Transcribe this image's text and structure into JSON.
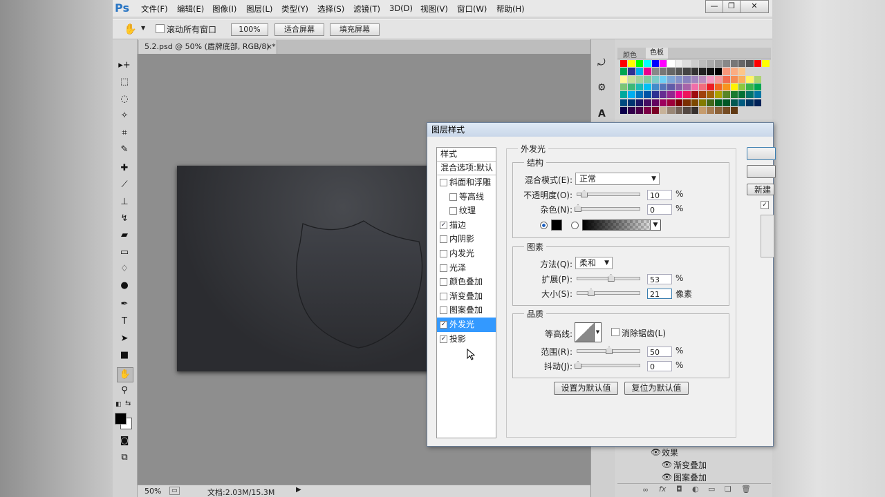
{
  "app": {
    "logo": "Ps",
    "document_title": "5.2.psd @ 50% (盾牌底部, RGB/8) *",
    "tab_close": "×"
  },
  "menu": [
    "文件(F)",
    "编辑(E)",
    "图像(I)",
    "图层(L)",
    "类型(Y)",
    "选择(S)",
    "滤镜(T)",
    "3D(D)",
    "视图(V)",
    "窗口(W)",
    "帮助(H)"
  ],
  "window_controls": {
    "minimize": "—",
    "restore": "❐",
    "close": "✕"
  },
  "options_bar": {
    "scroll_all_windows": "滚动所有窗口",
    "zoom_100": "100%",
    "fit_screen": "适合屏幕",
    "fill_screen": "填充屏幕"
  },
  "status": {
    "zoom": "50%",
    "doc_info": "文档:2.03M/15.3M"
  },
  "color_panel": {
    "tab_color": "颜色",
    "tab_swatches": "色板"
  },
  "swatch_colors": [
    [
      "#ff0000",
      "#ffff00",
      "#00ff00",
      "#00ffff",
      "#0000ff",
      "#ff00ff",
      "#ffffff",
      "#eeeeee",
      "#dddddd",
      "#cccccc",
      "#bbbbbb",
      "#aaaaaa",
      "#999999",
      "#888888",
      "#777777",
      "#666666",
      "#555555",
      "#ff0000",
      "#ffff00"
    ],
    [
      "#00a651",
      "#2e3192",
      "#00aeef",
      "#ec008c",
      "#888888",
      "#777777",
      "#666666",
      "#555555",
      "#444444",
      "#333333",
      "#222222",
      "#111111",
      "#000000",
      "#f7977a",
      "#fbad82",
      "#fdc68a"
    ],
    [
      "#fff79a",
      "#c4df9b",
      "#a3d39c",
      "#82ca9d",
      "#7bcdc8",
      "#6ecff6",
      "#7ea7d8",
      "#8493ca",
      "#8882be",
      "#a187be",
      "#bc8dbf",
      "#f49ac2",
      "#f6989d",
      "#f26c4f",
      "#f68e55",
      "#fbaf5c",
      "#fff467",
      "#acd372"
    ],
    [
      "#7cc576",
      "#3bb878",
      "#1abbb4",
      "#00bff3",
      "#438cca",
      "#5574b9",
      "#605ca8",
      "#855fa8",
      "#a763a8",
      "#f06ea9",
      "#f26d7d",
      "#ed1c24",
      "#f26522",
      "#f7941d",
      "#fff200",
      "#8dc73f",
      "#39b54a",
      "#00a651"
    ],
    [
      "#00a99d",
      "#00aeef",
      "#0072bc",
      "#0054a6",
      "#2e3192",
      "#662d91",
      "#92278f",
      "#ec008c",
      "#ed145b",
      "#9e0b0f",
      "#a0410d",
      "#a36209",
      "#aba000",
      "#598527",
      "#197b30",
      "#007236",
      "#00746b",
      "#0076a3"
    ],
    [
      "#004b80",
      "#003471",
      "#1b1464",
      "#440e62",
      "#630460",
      "#9e005d",
      "#9e0039",
      "#790000",
      "#7b2e00",
      "#7d4900",
      "#827b00",
      "#406618",
      "#005e20",
      "#005826",
      "#005952",
      "#005b7f",
      "#003663",
      "#002157"
    ],
    [
      "#0d004c",
      "#32004b",
      "#4b0049",
      "#7b0046",
      "#7a0026",
      "#c7b299",
      "#998675",
      "#736357",
      "#534741",
      "#37302d",
      "#c69c6d",
      "#a67c52",
      "#8c6239",
      "#754c24",
      "#603913"
    ]
  ],
  "dialog": {
    "title": "图层样式",
    "list_header": "样式",
    "blend_options": "混合选项:默认",
    "effects": [
      {
        "label": "斜面和浮雕",
        "checked": false,
        "indent": 0
      },
      {
        "label": "等高线",
        "checked": false,
        "indent": 1
      },
      {
        "label": "纹理",
        "checked": false,
        "indent": 1
      },
      {
        "label": "描边",
        "checked": true,
        "indent": 0
      },
      {
        "label": "内阴影",
        "checked": false,
        "indent": 0
      },
      {
        "label": "内发光",
        "checked": false,
        "indent": 0
      },
      {
        "label": "光泽",
        "checked": false,
        "indent": 0
      },
      {
        "label": "颜色叠加",
        "checked": false,
        "indent": 0
      },
      {
        "label": "渐变叠加",
        "checked": false,
        "indent": 0
      },
      {
        "label": "图案叠加",
        "checked": false,
        "indent": 0
      },
      {
        "label": "外发光",
        "checked": true,
        "indent": 0,
        "selected": true
      },
      {
        "label": "投影",
        "checked": true,
        "indent": 0
      }
    ],
    "section_title": "外发光",
    "structure": {
      "title": "结构",
      "blend_mode_label": "混合模式(E):",
      "blend_mode_value": "正常",
      "opacity_label": "不透明度(O):",
      "opacity_value": "10",
      "noise_label": "杂色(N):",
      "noise_value": "0",
      "percent": "%"
    },
    "elements": {
      "title": "图素",
      "method_label": "方法(Q):",
      "method_value": "柔和",
      "spread_label": "扩展(P):",
      "spread_value": "53",
      "size_label": "大小(S):",
      "size_value": "21",
      "size_unit": "像素",
      "percent": "%"
    },
    "quality": {
      "title": "品质",
      "contour_label": "等高线:",
      "antialias_label": "消除锯齿(L)",
      "range_label": "范围(R):",
      "range_value": "50",
      "jitter_label": "抖动(J):",
      "jitter_value": "0",
      "percent": "%"
    },
    "make_default": "设置为默认值",
    "reset_default": "复位为默认值",
    "new_style": "新建"
  },
  "layers": {
    "effects_label": "效果",
    "items": [
      "渐变叠加",
      "图案叠加"
    ]
  },
  "slider_levels": {
    "opacity": 0.1,
    "noise": 0.0,
    "spread": 0.53,
    "size": 0.21,
    "range": 0.5,
    "jitter": 0.0
  }
}
